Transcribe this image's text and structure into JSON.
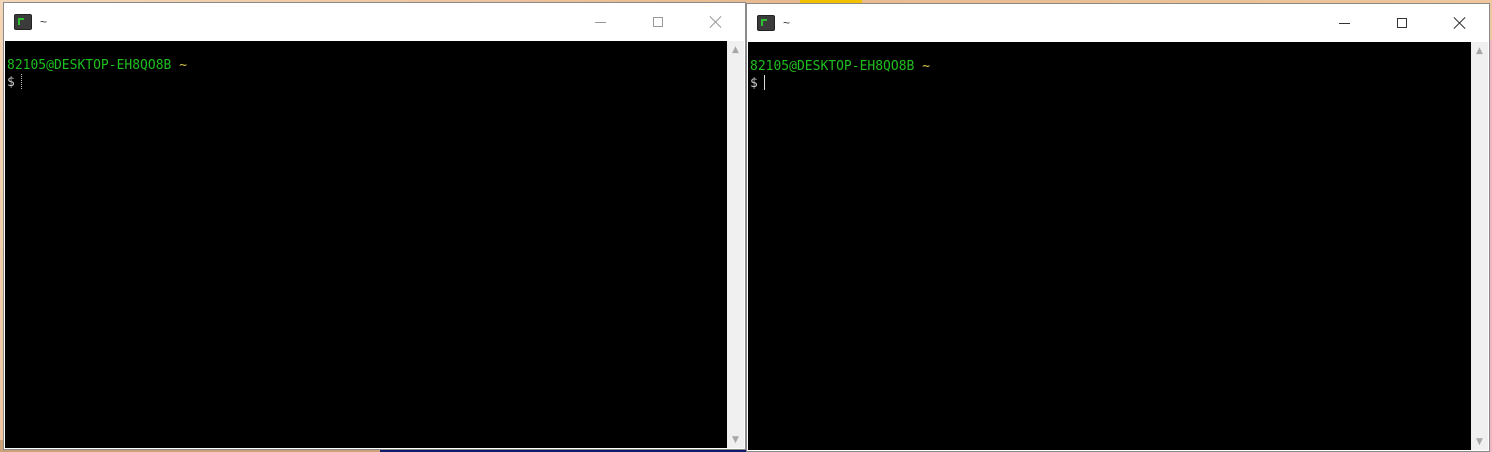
{
  "windows": [
    {
      "title": "~",
      "active": false,
      "terminal": {
        "prompt_user": "82105@DESKTOP-EH8QO8B",
        "prompt_path": "~",
        "prompt_symbol": "$"
      },
      "controls": [
        "minimize-icon",
        "maximize-icon",
        "close-icon"
      ]
    },
    {
      "title": "~",
      "active": true,
      "terminal": {
        "prompt_user": "82105@DESKTOP-EH8QO8B",
        "prompt_path": "~",
        "prompt_symbol": "$"
      },
      "controls": [
        "minimize-icon",
        "maximize-icon",
        "close-icon"
      ]
    }
  ],
  "colors": {
    "prompt_user": "#1fbf1f",
    "prompt_path": "#d8c64a",
    "terminal_bg": "#000000"
  }
}
